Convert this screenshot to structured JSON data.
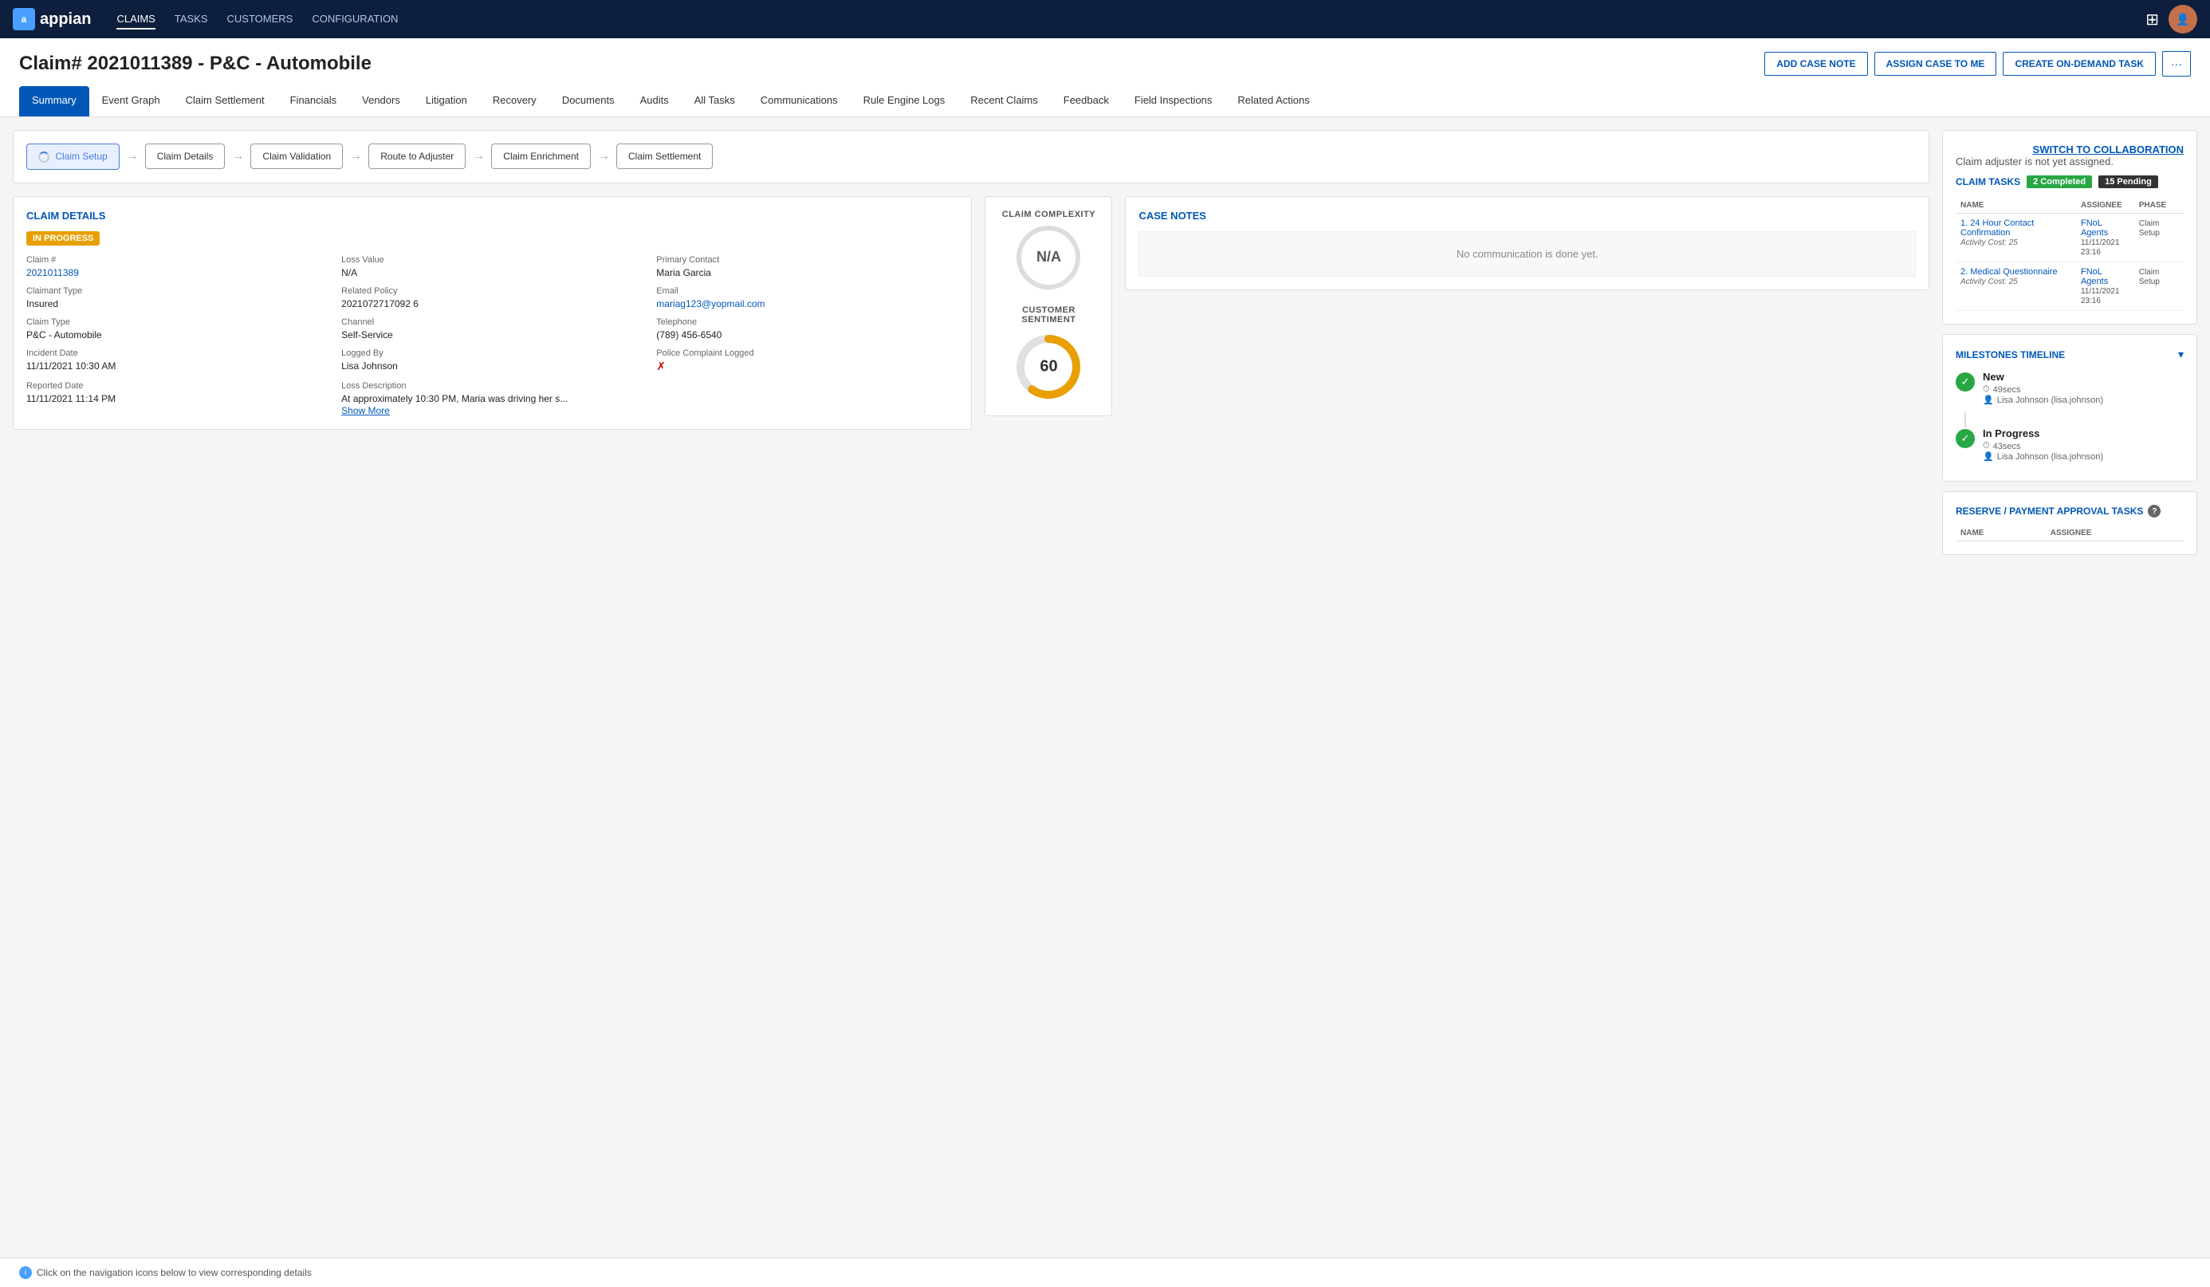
{
  "nav": {
    "logo": "appian",
    "items": [
      {
        "label": "CLAIMS",
        "active": true
      },
      {
        "label": "TASKS",
        "active": false
      },
      {
        "label": "CUSTOMERS",
        "active": false
      },
      {
        "label": "CONFIGURATION",
        "active": false
      }
    ]
  },
  "header": {
    "title": "Claim# 2021011389 - P&C - Automobile",
    "actions": {
      "add_case_note": "ADD CASE NOTE",
      "assign_case": "ASSIGN CASE TO ME",
      "create_task": "CREATE ON-DEMAND TASK",
      "more": "···"
    }
  },
  "tabs": [
    {
      "label": "Summary",
      "active": true
    },
    {
      "label": "Event Graph",
      "active": false
    },
    {
      "label": "Claim Settlement",
      "active": false
    },
    {
      "label": "Financials",
      "active": false
    },
    {
      "label": "Vendors",
      "active": false
    },
    {
      "label": "Litigation",
      "active": false
    },
    {
      "label": "Recovery",
      "active": false
    },
    {
      "label": "Documents",
      "active": false
    },
    {
      "label": "Audits",
      "active": false
    },
    {
      "label": "All Tasks",
      "active": false
    },
    {
      "label": "Communications",
      "active": false
    },
    {
      "label": "Rule Engine Logs",
      "active": false
    },
    {
      "label": "Recent Claims",
      "active": false
    },
    {
      "label": "Feedback",
      "active": false
    },
    {
      "label": "Field Inspections",
      "active": false
    },
    {
      "label": "Related Actions",
      "active": false
    }
  ],
  "workflow": {
    "steps": [
      {
        "label": "Claim Setup",
        "active": true
      },
      {
        "label": "Claim Details",
        "active": false
      },
      {
        "label": "Claim Validation",
        "active": false
      },
      {
        "label": "Route to Adjuster",
        "active": false
      },
      {
        "label": "Claim Enrichment",
        "active": false
      },
      {
        "label": "Claim Settlement",
        "active": false
      }
    ]
  },
  "claim_details": {
    "section_title": "CLAIM DETAILS",
    "status_badge": "IN PROGRESS",
    "fields": {
      "claim_number_label": "Claim #",
      "claim_number_value": "2021011389",
      "loss_value_label": "Loss Value",
      "loss_value_value": "N/A",
      "primary_contact_label": "Primary Contact",
      "primary_contact_value": "Maria Garcia",
      "claimant_type_label": "Claimant Type",
      "claimant_type_value": "Insured",
      "related_policy_label": "Related Policy",
      "related_policy_value": "2021072717092 6",
      "email_label": "Email",
      "email_value": "mariag123@yopmail.com",
      "claim_type_label": "Claim Type",
      "claim_type_value": "P&C - Automobile",
      "channel_label": "Channel",
      "channel_value": "Self-Service",
      "telephone_label": "Telephone",
      "telephone_value": "(789) 456-6540",
      "incident_date_label": "Incident Date",
      "incident_date_value": "11/11/2021 10:30 AM",
      "logged_by_label": "Logged By",
      "logged_by_value": "Lisa Johnson",
      "police_complaint_label": "Police Complaint Logged",
      "police_complaint_value": "✗",
      "reported_date_label": "Reported Date",
      "reported_date_value": "11/11/2021 11:14 PM",
      "loss_description_label": "Loss Description",
      "loss_description_value": "At approximately 10:30 PM, Maria was driving her s...",
      "show_more": "Show More"
    }
  },
  "complexity": {
    "label": "CLAIM COMPLEXITY",
    "value": "N/A"
  },
  "sentiment": {
    "label": "CUSTOMER SENTIMENT",
    "value": 60,
    "max": 100
  },
  "case_notes": {
    "title": "CASE NOTES",
    "empty_message": "No communication is done yet."
  },
  "right_panel": {
    "switch_collab": "SWITCH TO COLLABORATION",
    "unassigned_text": "Claim adjuster is not yet assigned.",
    "claim_tasks_title": "CLAIM TASKS",
    "badge_completed": "2 Completed",
    "badge_pending": "15 Pending",
    "table_headers": {
      "name": "NAME",
      "assignee": "ASSIGNEE",
      "phase": "PHASE"
    },
    "tasks": [
      {
        "name": "1. 24 Hour Contact Confirmation",
        "cost": "Activity Cost: 25",
        "assignee": "FNoL Agents",
        "assignee_date": "11/11/2021",
        "assignee_time": "23:16",
        "phase": "Claim Setup"
      },
      {
        "name": "2. Medical Questionnaire",
        "cost": "Activity Cost: 25",
        "assignee": "FNoL Agents",
        "assignee_date": "11/11/2021",
        "assignee_time": "23:16",
        "phase": "Claim Setup"
      }
    ],
    "milestones_title": "MILESTONES TIMELINE",
    "milestones": [
      {
        "name": "New",
        "duration": "49secs",
        "user": "Lisa Johnson (lisa.johnson)"
      },
      {
        "name": "In Progress",
        "duration": "43secs",
        "user": "Lisa Johnson (lisa.johnson)"
      }
    ],
    "reserve_title": "RESERVE / PAYMENT APPROVAL TASKS",
    "reserve_table_headers": {
      "name": "NAME",
      "assignee": "ASSIGNEE"
    }
  },
  "bottom_tip": "Click on the navigation icons below to view corresponding details"
}
